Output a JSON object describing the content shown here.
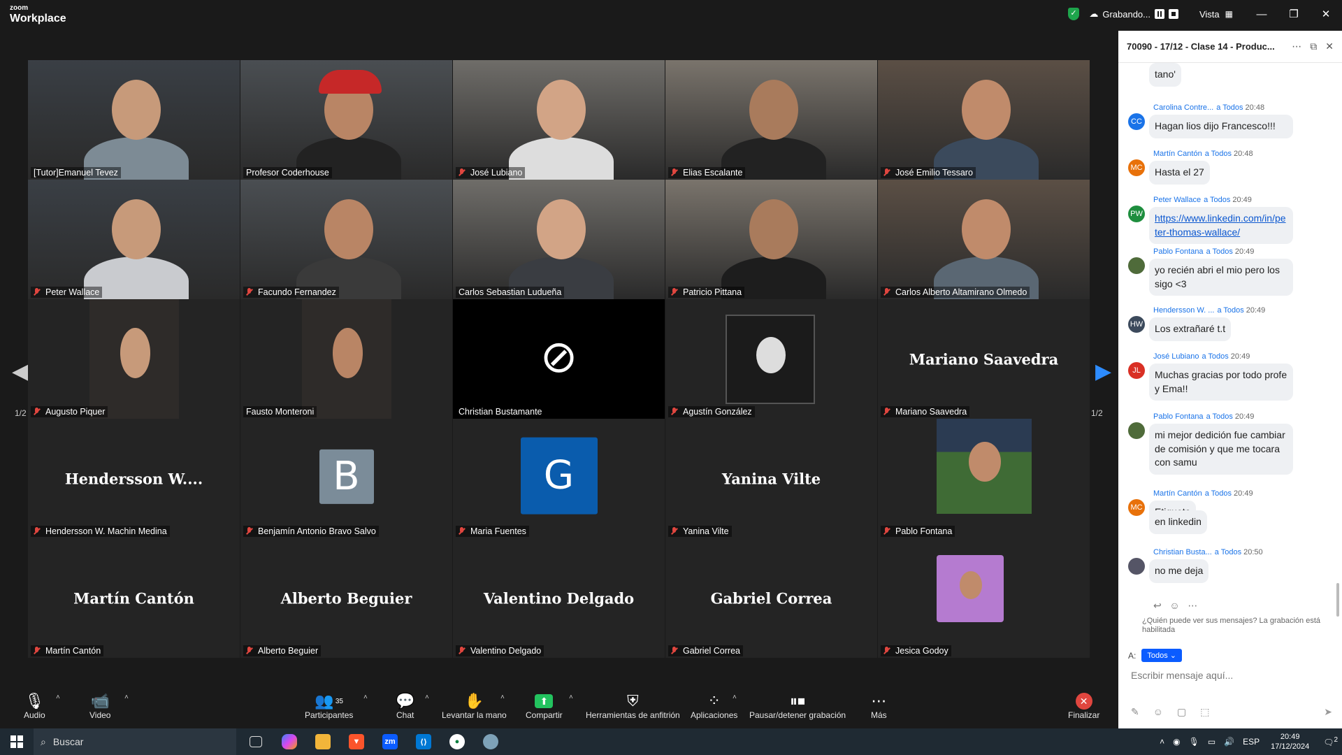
{
  "app": {
    "brand_top": "zoom",
    "brand_bottom": "Workplace"
  },
  "titlebar": {
    "recording": "Grabando...",
    "view": "Vista"
  },
  "pager": {
    "left": "1/2",
    "right": "1/2"
  },
  "participants": [
    {
      "name": "[Tutor]Emanuel Tevez",
      "muted": false,
      "kind": "video"
    },
    {
      "name": "Profesor Coderhouse",
      "muted": false,
      "kind": "video",
      "active": true
    },
    {
      "name": "José Lubiano",
      "muted": true,
      "kind": "video"
    },
    {
      "name": "Elias Escalante",
      "muted": true,
      "kind": "video"
    },
    {
      "name": "José Emilio Tessaro",
      "muted": true,
      "kind": "video"
    },
    {
      "name": "Peter Wallace",
      "muted": true,
      "kind": "video"
    },
    {
      "name": "Facundo Fernandez",
      "muted": true,
      "kind": "video"
    },
    {
      "name": "Carlos Sebastian Ludueña",
      "muted": false,
      "kind": "video"
    },
    {
      "name": "Patricio Pittana",
      "muted": true,
      "kind": "video"
    },
    {
      "name": "Carlos Alberto Altamirano Olmedo",
      "muted": true,
      "kind": "video"
    },
    {
      "name": "Augusto Piquer",
      "muted": true,
      "kind": "video"
    },
    {
      "name": "Fausto Monteroni",
      "muted": false,
      "kind": "video"
    },
    {
      "name": "Christian Bustamante",
      "muted": false,
      "kind": "camoff"
    },
    {
      "name": "Agustín González",
      "muted": true,
      "kind": "photo"
    },
    {
      "name": "Mariano Saavedra",
      "muted": true,
      "kind": "name",
      "big": "Mariano Saavedra"
    },
    {
      "name": "Hendersson W. Machin Medina",
      "muted": true,
      "kind": "name",
      "big": "Hendersson  W...."
    },
    {
      "name": "Benjamín Antonio Bravo Salvo",
      "muted": true,
      "kind": "letter",
      "letter": "B",
      "color": "#7b8c99"
    },
    {
      "name": "Maria Fuentes",
      "muted": true,
      "kind": "letter",
      "letter": "G",
      "color": "#0a5cad"
    },
    {
      "name": "Yanina Vilte",
      "muted": true,
      "kind": "name",
      "big": "Yanina Vilte"
    },
    {
      "name": "Pablo Fontana",
      "muted": true,
      "kind": "photo"
    },
    {
      "name": "Martín Cantón",
      "muted": true,
      "kind": "name",
      "big": "Martín Cantón"
    },
    {
      "name": "Alberto Beguier",
      "muted": true,
      "kind": "name",
      "big": "Alberto Beguier"
    },
    {
      "name": "Valentino Delgado",
      "muted": true,
      "kind": "name",
      "big": "Valentino Delgado"
    },
    {
      "name": "Gabriel Correa",
      "muted": true,
      "kind": "name",
      "big": "Gabriel Correa"
    },
    {
      "name": "Jesica Godoy",
      "muted": true,
      "kind": "photo"
    }
  ],
  "toolbar": {
    "audio": "Audio",
    "video": "Video",
    "participants": "Participantes",
    "participants_count": "35",
    "chat": "Chat",
    "raise_hand": "Levantar la mano",
    "share": "Compartir",
    "host_tools": "Herramientas de anfitrión",
    "apps": "Aplicaciones",
    "pause_rec": "Pausar/detener grabación",
    "more": "Más",
    "end": "Finalizar"
  },
  "chat": {
    "title": "70090 - 17/12 - Clase 14 - Produc...",
    "messages": [
      {
        "sender": "",
        "to": "",
        "time": "",
        "text": "tano'",
        "initials": "",
        "avcolor": ""
      },
      {
        "sender": "Carolina Contre...",
        "to": "a Todos",
        "time": "20:48",
        "text": "Hagan lios dijo Francesco!!!",
        "initials": "CC",
        "avcolor": "#1a73e8"
      },
      {
        "sender": "Martín Cantón",
        "to": "a Todos",
        "time": "20:48",
        "text": "Hasta el 27",
        "initials": "MC",
        "avcolor": "#e8710a"
      },
      {
        "sender": "Peter Wallace",
        "to": "a Todos",
        "time": "20:49",
        "text": "https://www.linkedin.com/in/peter-thomas-wallace/",
        "initials": "PW",
        "avcolor": "#1e8e3e"
      },
      {
        "sender": "Pablo Fontana",
        "to": "a Todos",
        "time": "20:49",
        "text": "yo recién abri el mio pero los sigo <3",
        "initials": "",
        "avcolor": "#4f6b3a"
      },
      {
        "sender": "Hendersson W. ...",
        "to": "a Todos",
        "time": "20:49",
        "text": "Los extrañaré t.t",
        "initials": "HW",
        "avcolor": "#3c4a5c"
      },
      {
        "sender": "José Lubiano",
        "to": "a Todos",
        "time": "20:49",
        "text": "Muchas gracias por todo profe y Ema!!",
        "initials": "JL",
        "avcolor": "#d93025"
      },
      {
        "sender": "Pablo Fontana",
        "to": "a Todos",
        "time": "20:49",
        "text": "mi mejor dedición fue cambiar de comisión y que me tocara con samu",
        "initials": "",
        "avcolor": "#4f6b3a"
      },
      {
        "sender": "Martín Cantón",
        "to": "a Todos",
        "time": "20:49",
        "text": "Etiqueta",
        "initials": "MC",
        "avcolor": "#e8710a"
      },
      {
        "sender": "",
        "to": "",
        "time": "",
        "text": "en linkedin",
        "initials": "",
        "avcolor": ""
      },
      {
        "sender": "Christian Busta...",
        "to": "a Todos",
        "time": "20:50",
        "text": "no me deja",
        "initials": "",
        "avcolor": "#556"
      }
    ],
    "visibility_note": "¿Quién puede ver sus mensajes? La grabación está habilitada",
    "to_label": "A:",
    "to_value": "Todos",
    "input_placeholder": "Escribir mensaje aquí..."
  },
  "taskbar": {
    "search": "Buscar",
    "lang": "ESP",
    "time": "20:49",
    "date": "17/12/2024",
    "notif_count": "2"
  }
}
